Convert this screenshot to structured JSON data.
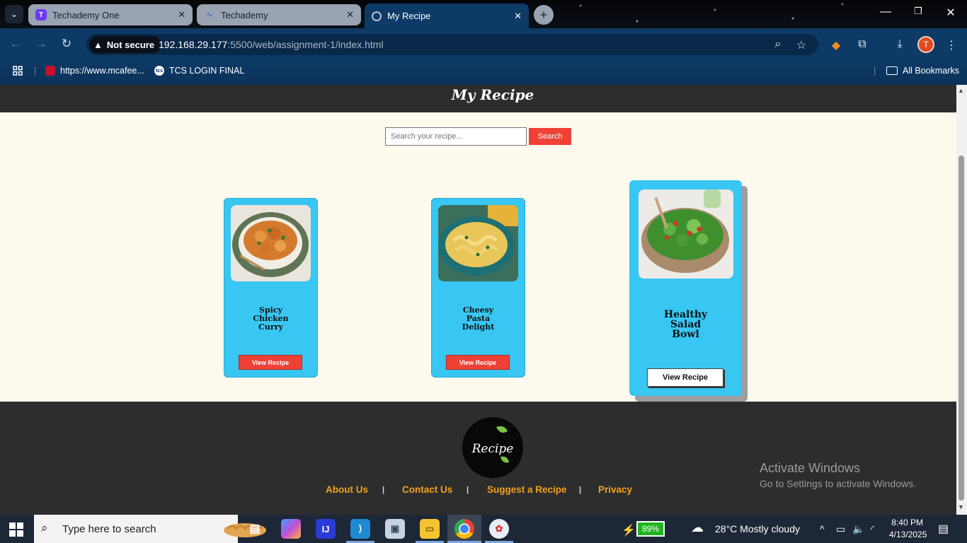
{
  "browser": {
    "tabs": [
      {
        "title": "Techademy One",
        "active": false
      },
      {
        "title": "Techademy",
        "active": false
      },
      {
        "title": "My Recipe",
        "active": true
      }
    ],
    "security_label": "Not secure",
    "url_host": "192.168.29.177",
    "url_path": ":5500/web/assignment-1/index.html",
    "avatar_letter": "T",
    "bookmarks": [
      {
        "label": "https://www.mcafee..."
      },
      {
        "label": "TCS LOGIN FINAL"
      }
    ],
    "all_bookmarks_label": "All Bookmarks"
  },
  "page": {
    "title": "My Recipe",
    "search": {
      "placeholder": "Search your recipe...",
      "button_label": "Search"
    },
    "recipes": [
      {
        "name_lines": [
          "Spicy",
          "Chicken",
          "Curry"
        ],
        "button_label": "View Recipe"
      },
      {
        "name_lines": [
          "Cheesy",
          "Pasta",
          "Delight"
        ],
        "button_label": "View Recipe"
      },
      {
        "name_lines": [
          "Healthy",
          "Salad",
          "Bowl"
        ],
        "button_label": "View Recipe"
      }
    ],
    "footer": {
      "logo_text": "Recipe",
      "links": [
        "About Us",
        "Contact Us",
        "Suggest a Recipe",
        "Privacy"
      ],
      "separator": "|"
    }
  },
  "watermark": {
    "line1": "Activate Windows",
    "line2": "Go to Settings to activate Windows."
  },
  "taskbar": {
    "search_placeholder": "Type here to search",
    "battery": "89%",
    "weather": "28°C  Mostly cloudy",
    "time": "8:40 PM",
    "date": "4/13/2025"
  },
  "colors": {
    "accent_red": "#ef4136",
    "card_blue": "#38c6f3",
    "footer_link": "#f2a11a",
    "dark_bar": "#2d2d2d"
  }
}
